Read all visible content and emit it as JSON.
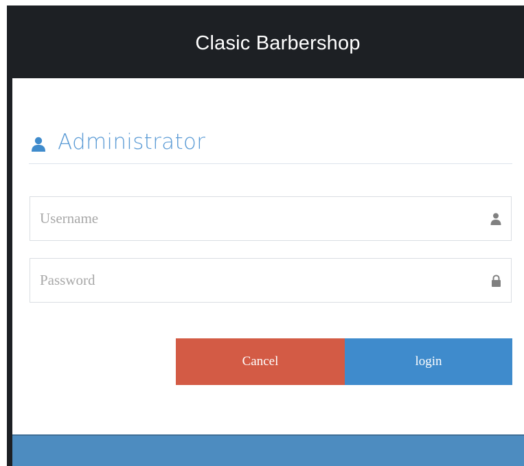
{
  "header": {
    "title": "Clasic Barbershop"
  },
  "panel": {
    "heading": "Administrator",
    "heading_icon": "user-icon"
  },
  "form": {
    "username": {
      "value": "",
      "placeholder": "Username",
      "icon": "user-icon"
    },
    "password": {
      "value": "",
      "placeholder": "Password",
      "icon": "lock-icon"
    },
    "cancel_label": "Cancel",
    "login_label": "login"
  },
  "colors": {
    "header_bg": "#1d2024",
    "accent": "#5b9bd5",
    "cancel": "#d35b45",
    "login": "#3f8bcc",
    "footer": "#4d8cc0"
  }
}
